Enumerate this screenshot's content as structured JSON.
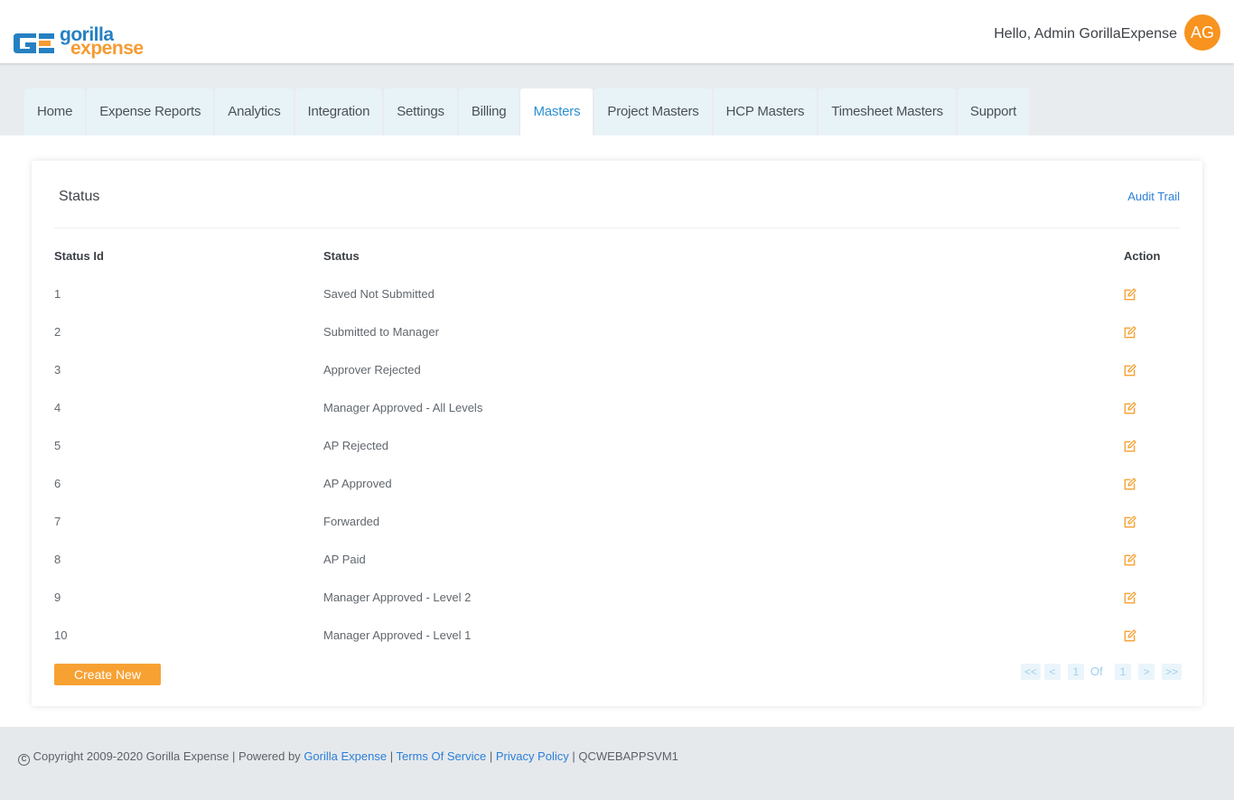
{
  "header": {
    "logo_top": "gorilla",
    "logo_bottom": "expense",
    "greeting": "Hello, Admin GorillaExpense",
    "avatar_initials": "AG"
  },
  "nav": {
    "tabs": [
      {
        "label": "Home",
        "active": false
      },
      {
        "label": "Expense Reports",
        "active": false
      },
      {
        "label": "Analytics",
        "active": false
      },
      {
        "label": "Integration",
        "active": false
      },
      {
        "label": "Settings",
        "active": false
      },
      {
        "label": "Billing",
        "active": false
      },
      {
        "label": "Masters",
        "active": true
      },
      {
        "label": "Project Masters",
        "active": false
      },
      {
        "label": "HCP Masters",
        "active": false
      },
      {
        "label": "Timesheet Masters",
        "active": false
      },
      {
        "label": "Support",
        "active": false
      }
    ]
  },
  "card": {
    "title": "Status",
    "audit_trail": "Audit Trail",
    "columns": {
      "id": "Status Id",
      "status": "Status",
      "action": "Action"
    },
    "rows": [
      {
        "id": "1",
        "status": "Saved Not Submitted"
      },
      {
        "id": "2",
        "status": "Submitted to Manager"
      },
      {
        "id": "3",
        "status": "Approver Rejected"
      },
      {
        "id": "4",
        "status": "Manager Approved - All Levels"
      },
      {
        "id": "5",
        "status": "AP Rejected"
      },
      {
        "id": "6",
        "status": "AP Approved"
      },
      {
        "id": "7",
        "status": "Forwarded"
      },
      {
        "id": "8",
        "status": "AP Paid"
      },
      {
        "id": "9",
        "status": "Manager Approved - Level 2"
      },
      {
        "id": "10",
        "status": "Manager Approved - Level 1"
      }
    ],
    "create_button": "Create New",
    "pager": {
      "first": "<<",
      "prev": "<",
      "current": "1",
      "of": "Of",
      "total": "1",
      "next": ">",
      "last": ">>"
    }
  },
  "footer": {
    "copyright": "Copyright 2009-2020 Gorilla Expense | Powered by",
    "powered_link": "Gorilla Expense",
    "sep1": "|",
    "terms": "Terms Of Service",
    "sep2": "|",
    "privacy": "Privacy Policy",
    "sep3": "|",
    "server": "QCWEBAPPSVM1"
  },
  "colors": {
    "accent_blue": "#2b8fd0",
    "accent_orange": "#f7a133",
    "tab_bg": "#e8f3f8"
  }
}
